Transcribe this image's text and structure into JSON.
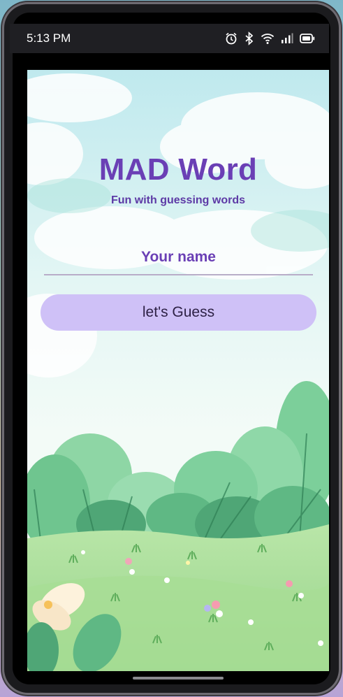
{
  "status_bar": {
    "time": "5:13 PM",
    "icons": [
      "alarm-icon",
      "bluetooth-icon",
      "wifi-icon",
      "signal-icon",
      "battery-icon"
    ]
  },
  "app": {
    "title": "MAD Word",
    "subtitle": "Fun with guessing words",
    "name_input": {
      "placeholder": "Your name",
      "value": ""
    },
    "guess_button_label": "let's Guess"
  },
  "colors": {
    "title": "#6a3fb5",
    "button_bg": "#cfc1f7",
    "button_text": "#2d2145",
    "input_underline": "#b8adc8"
  }
}
